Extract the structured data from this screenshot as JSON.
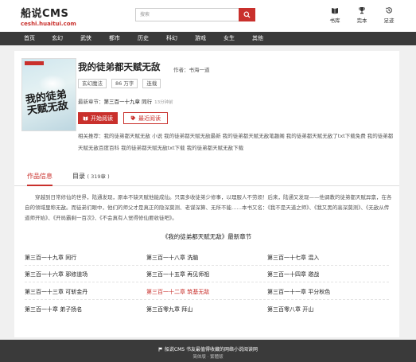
{
  "site": {
    "name": "船说CMS",
    "url": "ceshi.huaitui.com"
  },
  "search": {
    "placeholder": "搜索"
  },
  "header_links": [
    {
      "icon": "book-icon",
      "label": "书库"
    },
    {
      "icon": "trophy-icon",
      "label": "完本"
    },
    {
      "icon": "history-icon",
      "label": "足迹"
    }
  ],
  "nav": [
    "首页",
    "玄幻",
    "武侠",
    "都市",
    "历史",
    "科幻",
    "游戏",
    "女生",
    "其他"
  ],
  "book": {
    "cover_text": "我的徒弟\n天赋无敌",
    "title": "我的徒弟都天赋无敌",
    "author": "作者：书海一道",
    "tags": [
      "玄幻魔法",
      "86 万字",
      "连载"
    ],
    "latest_label": "最新章节：",
    "latest_chapter": "第三百一十九章 同行",
    "latest_time": "13分钟前",
    "read_button": "开始阅读",
    "recent_button": "最近阅读",
    "related_text": "相关推荐：我的徒弟都天赋无敌 小说 我的徒弟都天赋无敌最新 我的徒弟都天赋无敌笔趣阁 我的徒弟都天赋无敌了txt下载免费 我的徒弟都天赋无敌百度百科 我的徒弟都天赋无敌txt下载 我的徒弟都天赋无敌下载"
  },
  "tabs": {
    "info": "作品信息",
    "catalog": "目录",
    "catalog_count": "( 319章 )"
  },
  "description": "穿越到日常修仙的世界，陆通发现，原本不缺天赋他能成仙。只需多收徒弟少修事，以理服人不劳烦！后来，陆通又发现——他调教的徒弟都天赋异禀，在各自的领域里称无敌。而徒弟们眼中，他们的师父才是真正的隐深莫测、老谋深算、无所不能……本书又名：《我不是天道之师》、《我又黑的高深莫测》、《无敌从传道师开始》、《开局霸剩一百次》、《不会真有人觉得修仙要收徒吧》。",
  "chapters_heading": "《我的徒弟都天赋无敌》最新章节",
  "chapters": [
    "第三百一十九章 同行",
    "第三百一十八章 洗脑",
    "第三百一十七章 混入",
    "第三百一十六章 邪修道场",
    "第三百一十五章 再见师祖",
    "第三百一十四章 邀战",
    "第三百一十三章 可斩金丹",
    "第三百一十二章 筑基无敌",
    "第三百一十一章 平分秋色",
    "第三百一十章 弟子扬名",
    "第三百零九章 拜山",
    "第三百零八章 开山"
  ],
  "highlight_chapter_index": 7,
  "footer": {
    "line1": "船说CMS 书友最值得收藏的网络小说阅读网",
    "line2": "简体版 · 繁體版"
  },
  "colors": {
    "accent": "#c9302c",
    "nav_bg": "#3a3a3a",
    "page_bg": "#f0f0f0"
  }
}
